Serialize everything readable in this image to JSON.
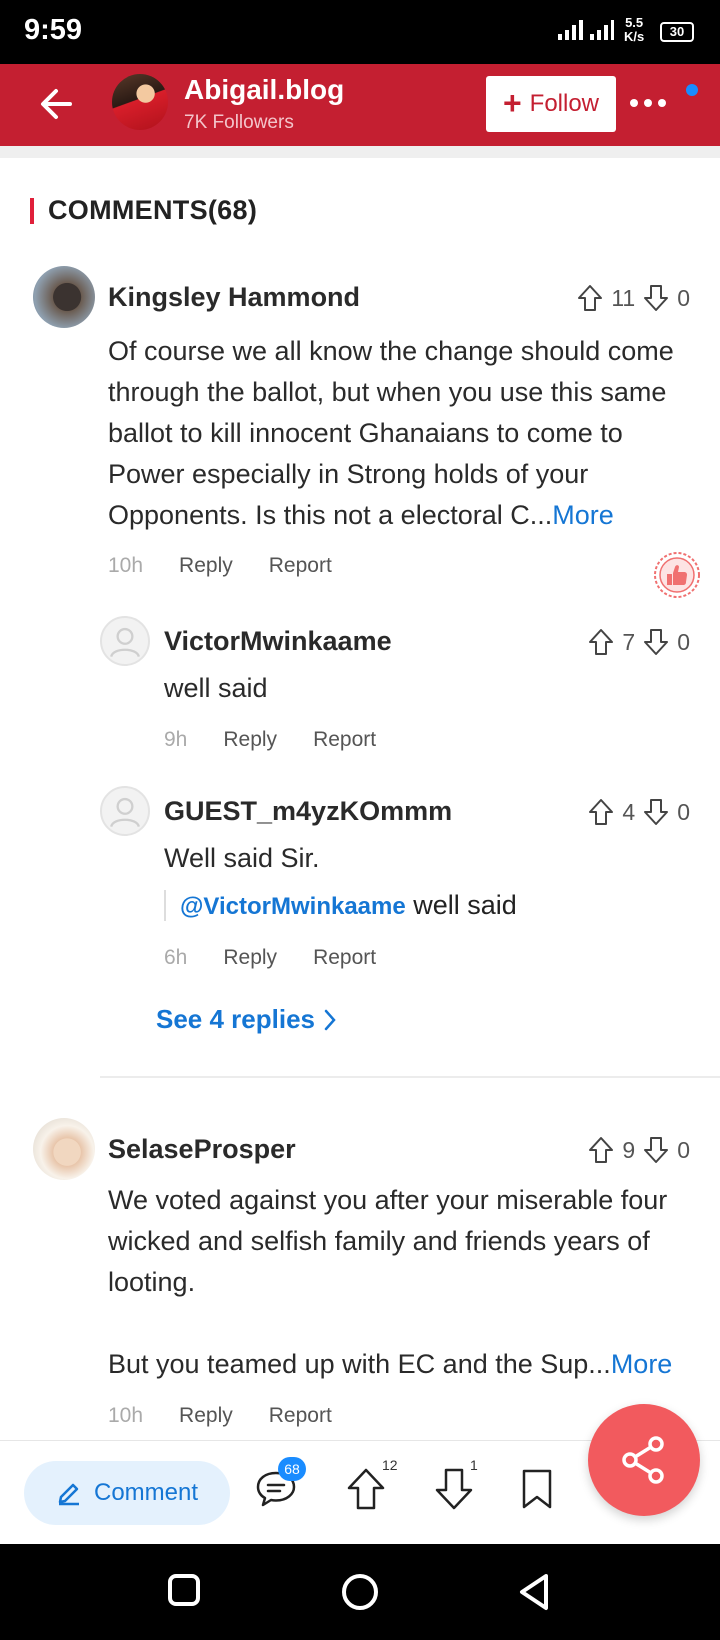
{
  "status": {
    "time": "9:59",
    "network": "4G",
    "speed_value": "5.5",
    "speed_unit": "K/s",
    "battery": "30"
  },
  "header": {
    "blog_name": "Abigail.blog",
    "followers": "7K Followers",
    "follow_label": "Follow"
  },
  "section": {
    "title": "COMMENTS(68)"
  },
  "comments": [
    {
      "author": "Kingsley Hammond",
      "up": "11",
      "down": "0",
      "text": "Of course we all know the change should come through the ballot, but when you use this same ballot to kill innocent Ghanaians to come to Power especially in Strong holds of your Opponents. Is this not a electoral C...",
      "more": "More",
      "time": "10h",
      "reply": "Reply",
      "report": "Report",
      "replies": [
        {
          "author": "VictorMwinkaame",
          "up": "7",
          "down": "0",
          "text": "well said",
          "time": "9h",
          "reply": "Reply",
          "report": "Report"
        },
        {
          "author": "GUEST_m4yzKOmmm",
          "up": "4",
          "down": "0",
          "text": "Well said Sir.",
          "quote_mention": "@VictorMwinkaame",
          "quote_text": " well said",
          "time": "6h",
          "reply": "Reply",
          "report": "Report"
        }
      ],
      "see_replies": "See 4 replies"
    },
    {
      "author": "SelaseProsper",
      "up": "9",
      "down": "0",
      "text": "We voted against you after your miserable four wicked and selfish family and friends years of looting.",
      "text2": "But you teamed up with EC and the Sup...",
      "more": "More",
      "time": "10h",
      "reply": "Reply",
      "report": "Report"
    }
  ],
  "bottom": {
    "comment_label": "Comment",
    "comments_count": "68",
    "upvotes": "12",
    "downvotes": "1"
  },
  "colors": {
    "header_red": "#c41f31",
    "link_blue": "#1576d4",
    "fab_red": "#f25a5e"
  }
}
